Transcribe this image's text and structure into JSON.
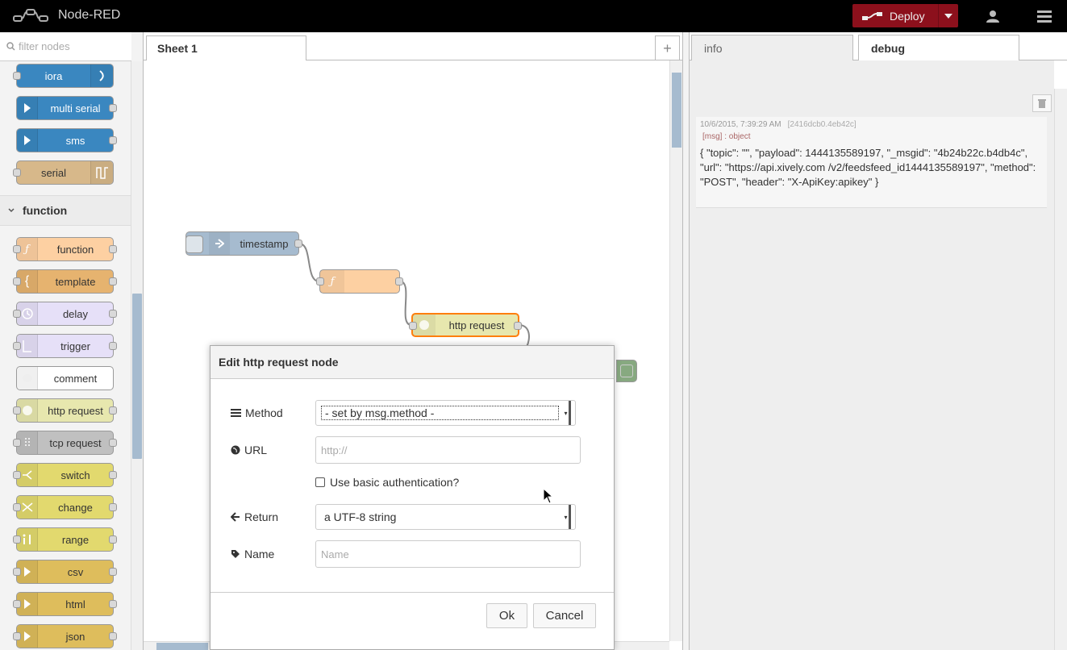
{
  "header": {
    "app_title": "Node-RED",
    "deploy_label": "Deploy"
  },
  "palette": {
    "filter_placeholder": "filter nodes",
    "input_nodes": [
      {
        "label": "iora",
        "color": "#3a87c0"
      },
      {
        "label": "multi serial",
        "color": "#3a87c0"
      },
      {
        "label": "sms",
        "color": "#3a87c0"
      },
      {
        "label": "serial",
        "color": "#d7b88a"
      }
    ],
    "category_function": "function",
    "function_nodes": [
      {
        "label": "function",
        "color": "#fdd0a2"
      },
      {
        "label": "template",
        "color": "#e6b36f"
      },
      {
        "label": "delay",
        "color": "#e6e0f8"
      },
      {
        "label": "trigger",
        "color": "#e6e0f8"
      },
      {
        "label": "comment",
        "color": "#ffffff"
      },
      {
        "label": "http request",
        "color": "#e7e7ae"
      },
      {
        "label": "tcp request",
        "color": "#c0c0c0"
      },
      {
        "label": "switch",
        "color": "#e2d96e"
      },
      {
        "label": "change",
        "color": "#e2d96e"
      },
      {
        "label": "range",
        "color": "#e2d96e"
      },
      {
        "label": "csv",
        "color": "#debd5c"
      },
      {
        "label": "html",
        "color": "#debd5c"
      },
      {
        "label": "json",
        "color": "#debd5c"
      }
    ]
  },
  "workspace": {
    "tab_label": "Sheet 1",
    "add_tab": "+",
    "flow_nodes": {
      "timestamp": "timestamp",
      "function": "",
      "http_request": "http request"
    }
  },
  "sidebar": {
    "tab_info": "info",
    "tab_debug": "debug",
    "debug": {
      "timestamp": "10/6/2015, 7:39:29 AM",
      "node_id": "[2416dcb0.4eb42c]",
      "topic": "[msg] : object",
      "payload": "{ \"topic\": \"\", \"payload\": 1444135589197, \"_msgid\": \"4b24b22c.b4db4c\", \"url\": \"https://api.xively.com /v2/feedsfeed_id1444135589197\", \"method\": \"POST\", \"header\": \"X-ApiKey:apikey\" }"
    }
  },
  "dialog": {
    "title": "Edit http request node",
    "method_label": "Method",
    "method_value": "- set by msg.method -",
    "url_label": "URL",
    "url_placeholder": "http://",
    "basic_auth_label": "Use basic authentication?",
    "return_label": "Return",
    "return_value": "a UTF-8 string",
    "name_label": "Name",
    "name_placeholder": "Name",
    "ok": "Ok",
    "cancel": "Cancel"
  }
}
